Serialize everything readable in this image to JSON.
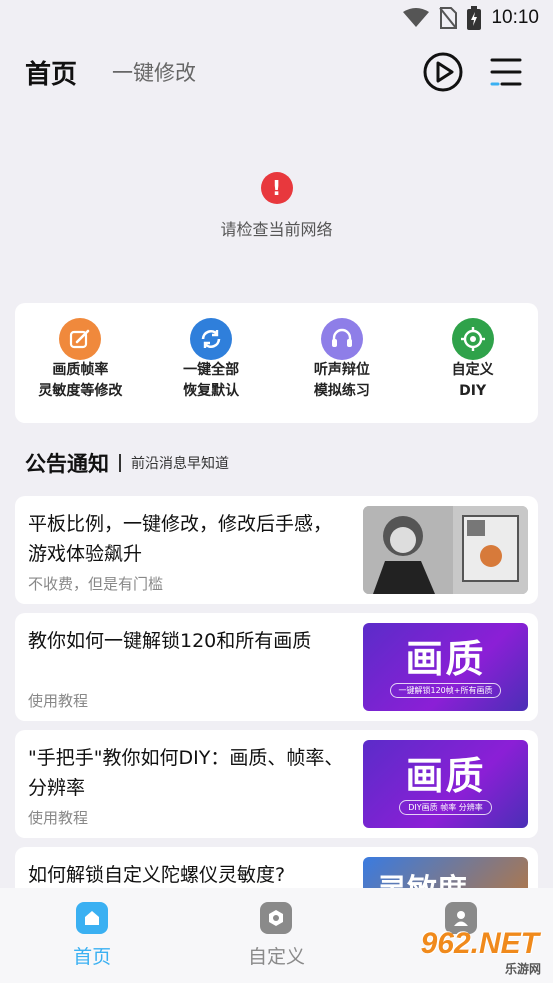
{
  "status_bar": {
    "time": "10:10"
  },
  "header": {
    "title": "首页",
    "subtitle": "一键修改"
  },
  "network": {
    "message": "请检查当前网络"
  },
  "quick_actions": [
    {
      "line1": "画质帧率",
      "line2": "灵敏度等修改",
      "icon": "edit-icon",
      "color": "#f0893c"
    },
    {
      "line1": "一键全部",
      "line2": "恢复默认",
      "icon": "refresh-icon",
      "color": "#2f7fdb"
    },
    {
      "line1": "听声辩位",
      "line2": "模拟练习",
      "icon": "headset-icon",
      "color": "#8e7ee8"
    },
    {
      "line1": "自定义",
      "line2": "DIY",
      "icon": "crosshair-icon",
      "color": "#2fa24a"
    }
  ],
  "announcements": {
    "title": "公告通知",
    "subtitle": "前沿消息早知道",
    "items": [
      {
        "title": "平板比例，一键修改，修改后手感，游戏体验飙升",
        "meta": "不收费，但是有门槛"
      },
      {
        "title": "教你如何一键解锁120和所有画质",
        "meta": "使用教程",
        "thumb_big": "画质",
        "thumb_small": "一键解锁120帧+所有画质"
      },
      {
        "title": "\"手把手\"教你如何DIY：画质、帧率、分辨率",
        "meta": "使用教程",
        "thumb_big": "画质",
        "thumb_small": "DIY画质   帧率   分辨率"
      },
      {
        "title": "如何解锁自定义陀螺仪灵敏度?",
        "meta": "",
        "thumb_big": "灵敏度"
      }
    ]
  },
  "bottom_nav": [
    {
      "label": "首页",
      "active": true
    },
    {
      "label": "自定义",
      "active": false
    },
    {
      "label": "",
      "active": false
    }
  ],
  "watermark": {
    "main": "962.NET",
    "sub": "乐游网"
  },
  "colors": {
    "accent": "#3ab0f2",
    "error": "#e8383d"
  }
}
